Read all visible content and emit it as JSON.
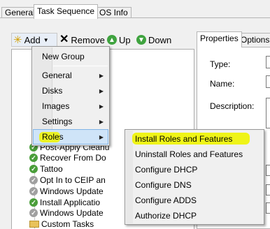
{
  "tabs": [
    {
      "label": "General",
      "active": false
    },
    {
      "label": "Task Sequence",
      "active": true
    },
    {
      "label": "OS Info",
      "active": false
    }
  ],
  "toolbar": {
    "add_label": "Add",
    "remove_label": "Remove",
    "up_label": "Up",
    "down_label": "Down"
  },
  "add_menu": {
    "items": [
      {
        "label": "New Group",
        "submenu": false
      },
      {
        "label": "General",
        "submenu": true
      },
      {
        "label": "Disks",
        "submenu": true
      },
      {
        "label": "Images",
        "submenu": true
      },
      {
        "label": "Settings",
        "submenu": true
      },
      {
        "label": "Roles",
        "submenu": true,
        "highlighted": true
      }
    ]
  },
  "roles_submenu": {
    "items": [
      {
        "label": "Install Roles and Features",
        "highlighted": true
      },
      {
        "label": "Uninstall Roles and Features"
      },
      {
        "label": "Configure DHCP"
      },
      {
        "label": "Configure DNS"
      },
      {
        "label": "Configure ADDS"
      },
      {
        "label": "Authorize DHCP"
      }
    ]
  },
  "tree": {
    "items": [
      {
        "label": "Post-Apply Cleanu",
        "icon": "check"
      },
      {
        "label": "Recover From Do",
        "icon": "check"
      },
      {
        "label": "Tattoo",
        "icon": "check"
      },
      {
        "label": "Opt In to CEIP an",
        "icon": "disabled"
      },
      {
        "label": "Windows Update",
        "icon": "disabled"
      },
      {
        "label": "Install Applicatio",
        "icon": "check"
      },
      {
        "label": "Windows Update",
        "icon": "disabled"
      },
      {
        "label": "Custom Tasks",
        "icon": "folder"
      }
    ]
  },
  "properties": {
    "tabs": [
      {
        "label": "Properties",
        "active": true
      },
      {
        "label": "Options",
        "active": false
      }
    ],
    "type_label": "Type:",
    "name_label": "Name:",
    "description_label": "Description:"
  },
  "colors": {
    "highlight_yellow": "#eef400",
    "menu_selection": "#cfe4f8",
    "check_green": "#4a9e3a"
  }
}
